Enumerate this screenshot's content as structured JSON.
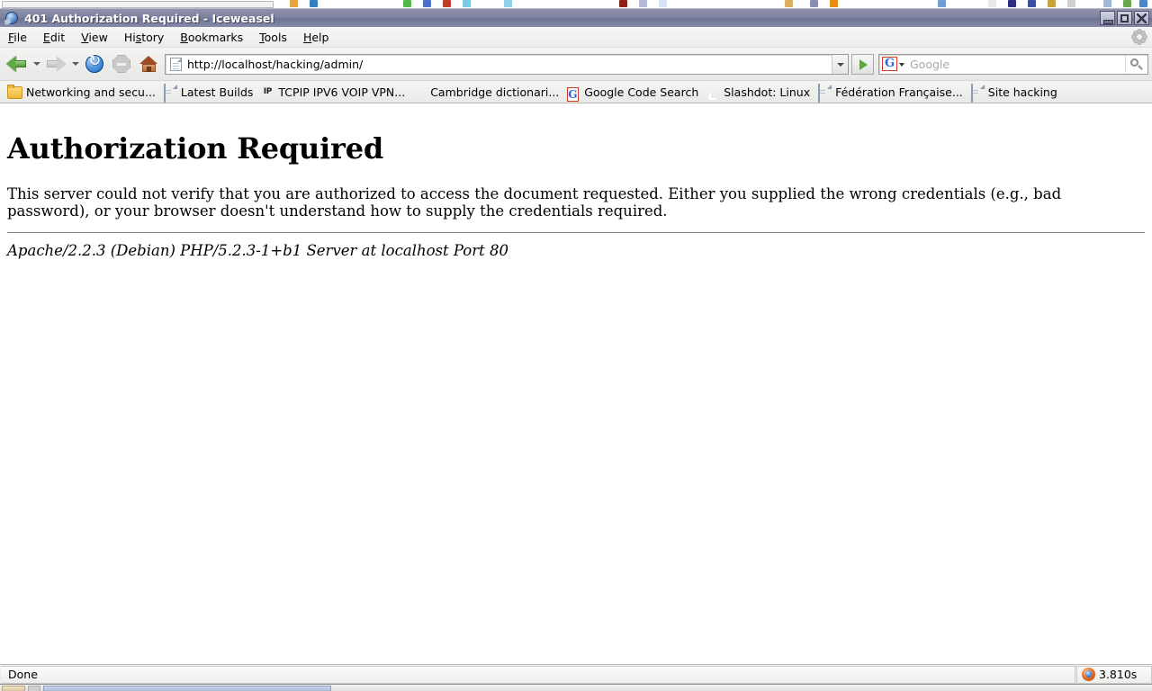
{
  "window": {
    "title": "401 Authorization Required - Iceweasel",
    "icon": "iceweasel-globe-icon",
    "controls": {
      "minimize": "Minimize",
      "maximize": "Maximize",
      "close": "Close"
    }
  },
  "menubar": {
    "items": [
      {
        "label": "File",
        "accesskey": "F"
      },
      {
        "label": "Edit",
        "accesskey": "E"
      },
      {
        "label": "View",
        "accesskey": "V"
      },
      {
        "label": "History",
        "accesskey": "s"
      },
      {
        "label": "Bookmarks",
        "accesskey": "B"
      },
      {
        "label": "Tools",
        "accesskey": "T"
      },
      {
        "label": "Help",
        "accesskey": "H"
      }
    ]
  },
  "toolbar": {
    "back": "Back",
    "back_dropdown": "Back history",
    "forward": "Forward",
    "forward_dropdown": "Forward history",
    "reload": "Reload",
    "stop": "Stop",
    "home": "Home",
    "go": "Go"
  },
  "urlbar": {
    "value": "http://localhost/hacking/admin/",
    "placeholder": "",
    "favicon": "generic-page-icon",
    "dropdown": "Show history"
  },
  "searchbar": {
    "engine": "G",
    "engine_name": "Google",
    "placeholder": "Google",
    "value": "",
    "submit": "Search"
  },
  "bookmarks": [
    {
      "label": "Networking and secu...",
      "icon": "folder-icon"
    },
    {
      "label": "Latest Builds",
      "icon": "page-icon"
    },
    {
      "label": "TCPIP IPV6 VOIP VPN...",
      "icon": "ip-icon",
      "icon_text": "IP"
    },
    {
      "label": "Cambridge dictionari...",
      "icon": "shield-icon"
    },
    {
      "label": "Google Code Search",
      "icon": "google-icon",
      "icon_text": "G"
    },
    {
      "label": "Slashdot: Linux",
      "icon": "rss-icon"
    },
    {
      "label": "Fédération Française...",
      "icon": "page-icon"
    },
    {
      "label": "Site hacking",
      "icon": "page-icon"
    }
  ],
  "page": {
    "heading": "Authorization Required",
    "body": "This server could not verify that you are authorized to access the document requested. Either you supplied the wrong credentials (e.g., bad password), or your browser doesn't understand how to supply the credentials required.",
    "signature": "Apache/2.2.3 (Debian) PHP/5.2.3-1+b1 Server at localhost Port 80"
  },
  "statusbar": {
    "status": "Done",
    "load_time": "3.810s",
    "timer_icon": "page-load-timer-icon"
  },
  "colors": {
    "titlebar": "#7d82a0",
    "chrome": "#f0f0ef",
    "page_background": "#ffffff",
    "text": "#000000",
    "back_arrow": "#63a943",
    "reload": "#4d93dd",
    "go_arrow": "#5aa83c",
    "rss_orange": "#e2720c",
    "google_blue": "#2b63d9"
  }
}
